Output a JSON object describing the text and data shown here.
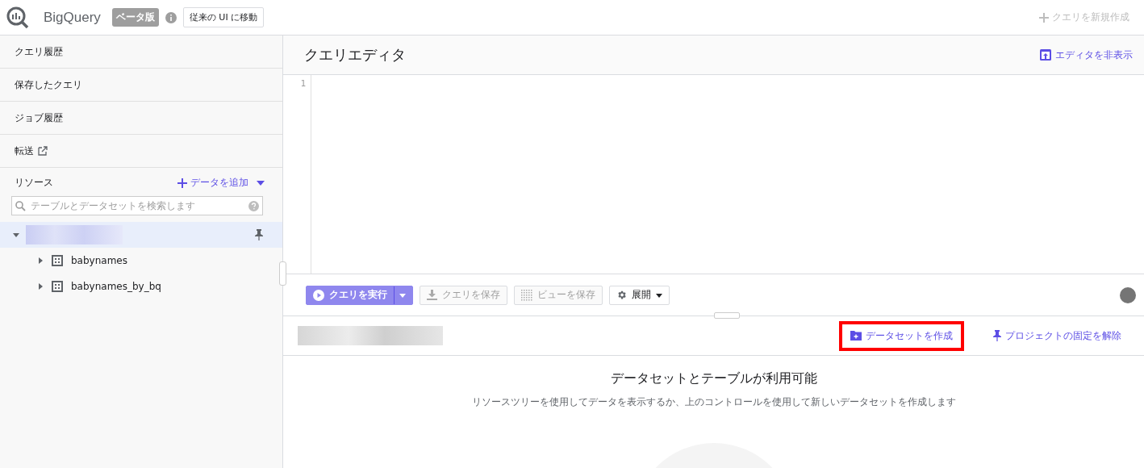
{
  "header": {
    "title": "BigQuery",
    "badge": "ベータ版",
    "classic_button": "従来の UI に移動",
    "new_query": {
      "label": "クエリを新規作成",
      "disabled": true
    }
  },
  "sidebar": {
    "nav": [
      {
        "label": "クエリ履歴",
        "external": false
      },
      {
        "label": "保存したクエリ",
        "external": false
      },
      {
        "label": "ジョブ履歴",
        "external": false
      },
      {
        "label": "転送",
        "external": true
      }
    ],
    "resources": {
      "title": "リソース",
      "add_data": "データを追加",
      "search": {
        "placeholder": "テーブルとデータセットを検索します"
      }
    },
    "tree": [
      {
        "selected": true,
        "expanded": true,
        "children": [
          {
            "label": "babynames",
            "expanded": false
          },
          {
            "label": "babynames_by_bq",
            "expanded": false
          }
        ]
      }
    ]
  },
  "editor": {
    "title": "クエリエディタ",
    "hide_editor": "エディタを非表示",
    "line_numbers": [
      "1"
    ],
    "toolbar": [
      {
        "kind": "run",
        "label": "クエリを実行",
        "disabled": false
      },
      {
        "kind": "save",
        "label": "クエリを保存",
        "disabled": true
      },
      {
        "kind": "view",
        "label": "ビューを保存",
        "disabled": true
      },
      {
        "kind": "more",
        "label": "展開",
        "disabled": false
      }
    ]
  },
  "dataset_panel": {
    "actions": [
      {
        "kind": "create",
        "label": "データセットを作成",
        "highlighted": true
      },
      {
        "kind": "unpin",
        "label": "プロジェクトの固定を解除",
        "highlighted": false
      }
    ],
    "empty_title": "データセットとテーブルが利用可能",
    "empty_text": "リソースツリーを使用してデータを表示するか、上のコントロールを使用して新しいデータセットを作成します"
  }
}
